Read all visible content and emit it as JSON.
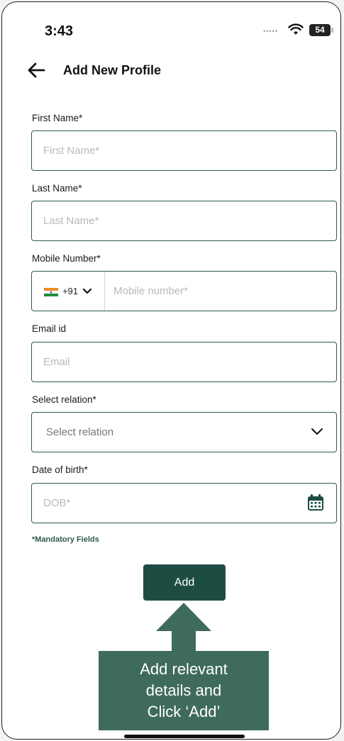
{
  "status_bar": {
    "time": "3:43",
    "battery": "54"
  },
  "header": {
    "title": "Add New Profile"
  },
  "form": {
    "first_name": {
      "label": "First Name*",
      "placeholder": "First Name*"
    },
    "last_name": {
      "label": "Last Name*",
      "placeholder": "Last Name*"
    },
    "mobile": {
      "label": "Mobile Number*",
      "country_code": "+91",
      "placeholder": "Mobile number*"
    },
    "email": {
      "label": "Email id",
      "placeholder": "Email"
    },
    "relation": {
      "label": "Select relation*",
      "placeholder": "Select relation"
    },
    "dob": {
      "label": "Date of birth*",
      "placeholder": "DOB*"
    },
    "mandatory_note": "*Mandatory Fields",
    "add_label": "Add"
  },
  "callout": {
    "line1": "Add relevant",
    "line2": "details and",
    "line3": "Click ‘Add’"
  },
  "colors": {
    "accent": "#1d4d42",
    "callout": "#3f6b5e",
    "border": "#2f5a4e"
  }
}
